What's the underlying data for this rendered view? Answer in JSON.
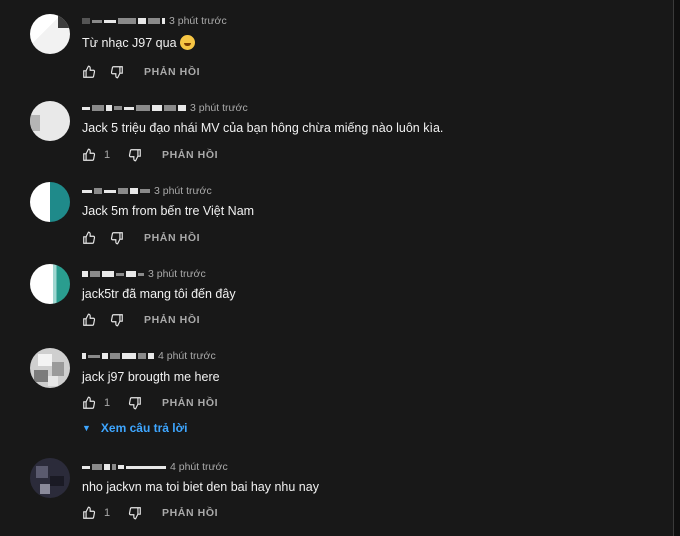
{
  "comments": [
    {
      "time": "3 phút trước",
      "text": "Từ nhạc J97 qua",
      "emoji": "rolling-on-floor-laughing",
      "likes": "",
      "reply_label": "PHẢN HỒI"
    },
    {
      "time": "3 phút trước",
      "text": "Jack 5 triệu đạo nhái MV của bạn hông chừa miếng nào luôn kìa.",
      "likes": "1",
      "reply_label": "PHẢN HỒI"
    },
    {
      "time": "3 phút trước",
      "text": "Jack 5m from bến tre Việt Nam",
      "likes": "",
      "reply_label": "PHẢN HỒI"
    },
    {
      "time": "3 phút trước",
      "text": "jack5tr đã mang tôi đến đây",
      "likes": "",
      "reply_label": "PHẢN HỒI"
    },
    {
      "time": "4 phút trước",
      "text": "jack j97 brougth me here",
      "likes": "1",
      "reply_label": "PHẢN HỒI"
    },
    {
      "time": "4 phút trước",
      "text": "nho jackvn ma toi biet den bai hay nhu nay",
      "likes": "1",
      "reply_label": "PHẢN HỒI"
    }
  ],
  "view_replies_label": "Xem câu trả lời",
  "colors": {
    "background": "#181818",
    "link": "#3ea6ff",
    "secondary_text": "#aaaaaa"
  }
}
